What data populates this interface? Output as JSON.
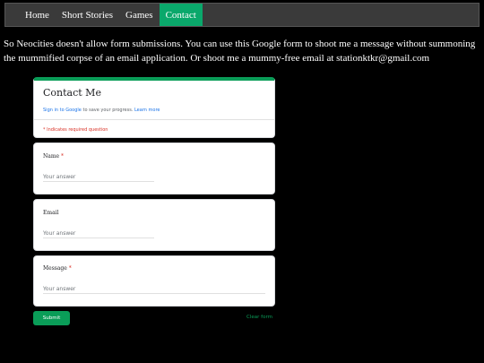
{
  "nav": {
    "items": [
      {
        "label": "Home"
      },
      {
        "label": "Short Stories"
      },
      {
        "label": "Games"
      },
      {
        "label": "Contact"
      }
    ],
    "active_index": 3,
    "active_color": "#0aa86b"
  },
  "intro_text": "So Neocities doesn't allow form submissions. You can use this Google form to shoot me a message without summoning the mummified corpse of an email application. Or shoot me a mummy-free email at stationktkr@gmail.com",
  "form": {
    "title": "Contact Me",
    "signin_link": "Sign in to Google",
    "signin_text": " to save your progress. ",
    "learn_more": "Learn more",
    "required_note": "* Indicates required question",
    "accent_color": "#0a9d58",
    "questions": [
      {
        "label": "Name",
        "required": "*",
        "placeholder": "Your answer"
      },
      {
        "label": "Email",
        "required": "",
        "placeholder": "Your answer"
      },
      {
        "label": "Message",
        "required": "*",
        "placeholder": "Your answer"
      }
    ],
    "submit_label": "Submit",
    "clear_label": "Clear form"
  }
}
